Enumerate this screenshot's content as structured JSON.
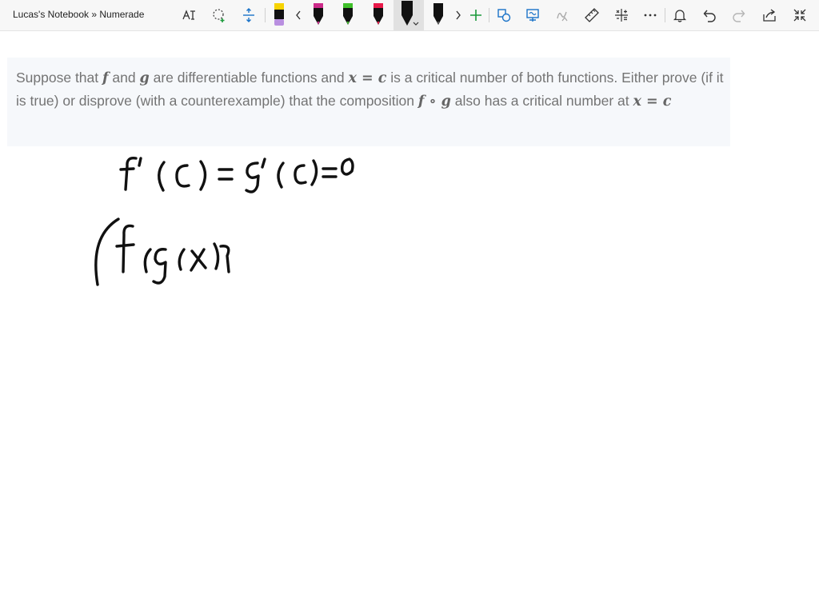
{
  "app": {
    "title": "Lucas's Notebook » Numerade"
  },
  "toolbar": {
    "icons": [
      "text-select-icon",
      "lasso-select-icon",
      "insert-space-icon",
      "highlighter-yellow",
      "chevron-left-icon",
      "pen-magenta",
      "pen-green",
      "pen-red",
      "pen-black-selected",
      "pen-black",
      "chevron-right-icon",
      "add-pen-icon",
      "ink-to-shape-icon",
      "ink-to-text-icon",
      "ink-to-math-icon",
      "ruler-icon",
      "math-icon",
      "more-icon",
      "notifications-icon",
      "undo-icon",
      "redo-icon",
      "share-icon",
      "fullscreen-icon"
    ],
    "colors": {
      "yellow": "#f7d300",
      "magenta": "#cc2a8a",
      "green": "#3fbf2a",
      "red": "#e8194a",
      "black": "#111111",
      "accent": "#1a73c8"
    }
  },
  "problem": {
    "t1": "Suppose that ",
    "f1": "f",
    "t2": " and ",
    "g1": "g",
    "t3": " are differentiable functions and ",
    "xc1": "x = c",
    "t4": " is a critical number of both functions. Either prove (if it is true) or disprove (with a counterexample) that the composition ",
    "fog": "f ∘ g",
    "t5": " also has a critical number at ",
    "xc2": "x = c"
  }
}
